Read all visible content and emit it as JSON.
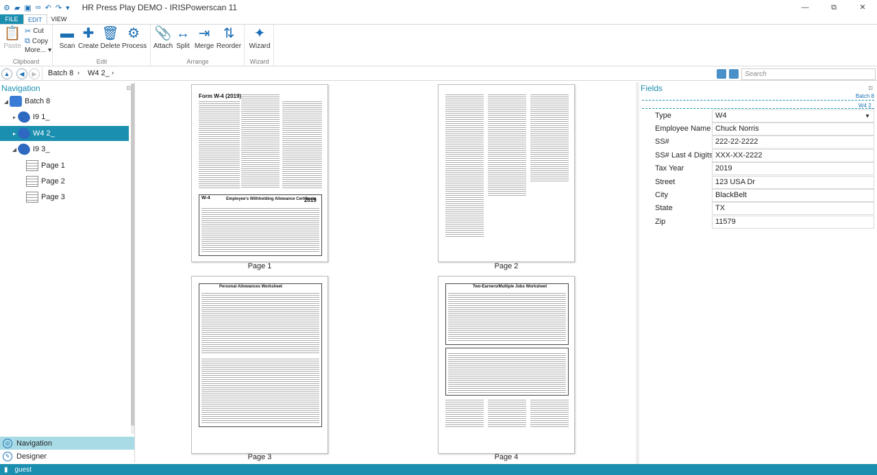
{
  "app": {
    "title": "HR Press Play DEMO - IRISPowerscan 11",
    "win": {
      "min": "—",
      "restore": "⧉",
      "close": "✕"
    }
  },
  "tabs": {
    "file": "FILE",
    "edit": "EDIT",
    "view": "VIEW"
  },
  "ribbon": {
    "clipboard": {
      "label": "Clipboard",
      "paste": "Paste",
      "cut": "Cut",
      "copy": "Copy",
      "more": "More..."
    },
    "edit": {
      "label": "Edit",
      "scan": "Scan",
      "create": "Create",
      "delete": "Delete",
      "process": "Process"
    },
    "arrange": {
      "label": "Arrange",
      "attach": "Attach",
      "split": "Split",
      "merge": "Merge",
      "reorder": "Reorder"
    },
    "wizard": {
      "label": "Wizard",
      "wizard": "Wizard"
    }
  },
  "breadcrumb": {
    "batch": "Batch 8",
    "doc": "W4 2_"
  },
  "search": {
    "placeholder": "Search"
  },
  "navigation": {
    "header": "Navigation",
    "tree": [
      {
        "label": "Batch 8",
        "type": "batch"
      },
      {
        "label": "I9 1_",
        "type": "doc"
      },
      {
        "label": "W4 2_",
        "type": "doc",
        "selected": true
      },
      {
        "label": "I9 3_",
        "type": "doc"
      },
      {
        "label": "Page 1",
        "type": "page"
      },
      {
        "label": "Page 2",
        "type": "page"
      },
      {
        "label": "Page 3",
        "type": "page"
      }
    ],
    "btn_navigation": "Navigation",
    "btn_designer": "Designer"
  },
  "pages": [
    {
      "label": "Page 1",
      "heading": "Form W-4 (2019)",
      "sub": "Employee's Withholding Allowance Certificate",
      "year": "2019"
    },
    {
      "label": "Page 2"
    },
    {
      "label": "Page 3",
      "heading": "Personal Allowances Worksheet"
    },
    {
      "label": "Page 4",
      "heading": "Two-Earners/Multiple Jobs Worksheet"
    }
  ],
  "fields": {
    "header": "Fields",
    "batch_label": "Batch 8",
    "doc_label": "W4 2_",
    "rows": [
      {
        "label": "Type",
        "value": "W4",
        "dropdown": true
      },
      {
        "label": "Employee Name",
        "value": "Chuck Norris"
      },
      {
        "label": "SS#",
        "value": "222-22-2222"
      },
      {
        "label": "SS# Last 4 Digits",
        "value": "XXX-XX-2222"
      },
      {
        "label": "Tax Year",
        "value": "2019"
      },
      {
        "label": "Street",
        "value": "123 USA Dr"
      },
      {
        "label": "City",
        "value": "BlackBelt"
      },
      {
        "label": "State",
        "value": "TX"
      },
      {
        "label": "Zip",
        "value": "11579"
      }
    ]
  },
  "status": {
    "user": "guest"
  }
}
